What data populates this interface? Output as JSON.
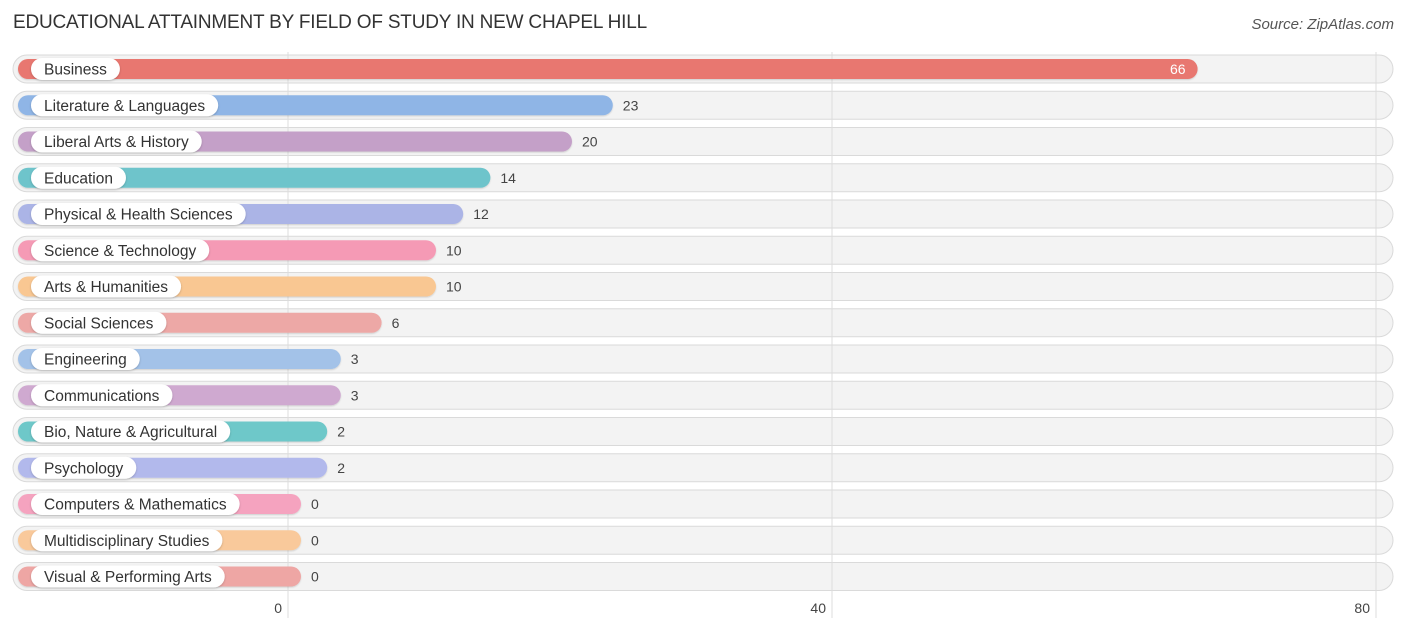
{
  "chart_data": {
    "type": "bar",
    "orientation": "horizontal",
    "title": "EDUCATIONAL ATTAINMENT BY FIELD OF STUDY IN NEW CHAPEL HILL",
    "source": "Source: ZipAtlas.com",
    "xlabel": "",
    "ylabel": "",
    "xlim": [
      0,
      80
    ],
    "grid": true,
    "ticks": [
      0,
      40,
      80
    ],
    "tick_labels": [
      "0",
      "40",
      "80"
    ],
    "categories": [
      "Business",
      "Literature & Languages",
      "Liberal Arts & History",
      "Education",
      "Physical & Health Sciences",
      "Science & Technology",
      "Arts & Humanities",
      "Social Sciences",
      "Engineering",
      "Communications",
      "Bio, Nature & Agricultural",
      "Psychology",
      "Computers & Mathematics",
      "Multidisciplinary Studies",
      "Visual & Performing Arts"
    ],
    "values": [
      66,
      23,
      20,
      14,
      12,
      10,
      10,
      6,
      3,
      3,
      2,
      2,
      0,
      0,
      0
    ],
    "value_labels": [
      "66",
      "23",
      "20",
      "14",
      "12",
      "10",
      "10",
      "6",
      "3",
      "3",
      "2",
      "2",
      "0",
      "0",
      "0"
    ],
    "colors": [
      "#e8776f",
      "#8fb5e6",
      "#c4a0c8",
      "#6ec4cb",
      "#abb4e6",
      "#f59ab5",
      "#f9c792",
      "#eda8a6",
      "#a3c2e8",
      "#cfa9d0",
      "#6ec8c9",
      "#b2b9ec",
      "#f5a3bf",
      "#f9c99b",
      "#eea6a4"
    ]
  }
}
